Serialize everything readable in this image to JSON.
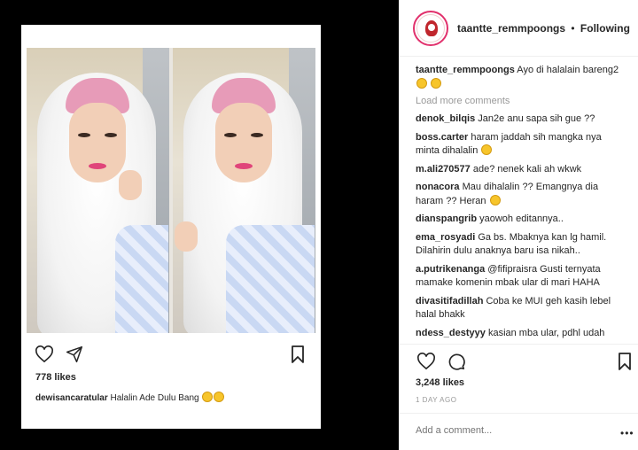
{
  "post": {
    "card_likes": "778 likes",
    "card_caption_user": "dewisancaratular",
    "card_caption_text": " Halalin Ade Dulu Bang "
  },
  "header": {
    "username": "taantte_remmpoongs",
    "separator": "•",
    "follow_label": "Following"
  },
  "caption": {
    "user": "taantte_remmpoongs",
    "text": " Ayo di halalain bareng2 "
  },
  "load_more": "Load more comments",
  "comments": [
    {
      "user": "denok_bilqis",
      "text": " Jan2e anu sapa sih gue ??"
    },
    {
      "user": "boss.carter",
      "text": " haram jaddah sih mangka nya minta dihalalin "
    },
    {
      "user": "m.ali270577",
      "text": " ade? nenek kali ah wkwk"
    },
    {
      "user": "nonacora",
      "text": " Mau dihalalin ?? Emangnya dia haram ?? Heran "
    },
    {
      "user": "dianspangrib",
      "text": " yaowoh editannya.."
    },
    {
      "user": "ema_rosyadi",
      "text": " Ga bs. Mbaknya kan lg hamil. Dilahirin dulu anaknya baru isa nikah.."
    },
    {
      "user": "a.putrikenanga",
      "text": " @fifipraisra Gusti ternyata mamake komenin mbak ular di mari HAHA"
    },
    {
      "user": "divasitifadillah",
      "text": " Coba ke MUI geh kasih lebel halal bhakk"
    },
    {
      "user": "ndess_destyyy",
      "text": " kasian mba ular, pdhl udah"
    }
  ],
  "likes": "3,248 likes",
  "date": "1 DAY AGO",
  "add_comment_placeholder": "Add a comment...",
  "more_label": "•••"
}
